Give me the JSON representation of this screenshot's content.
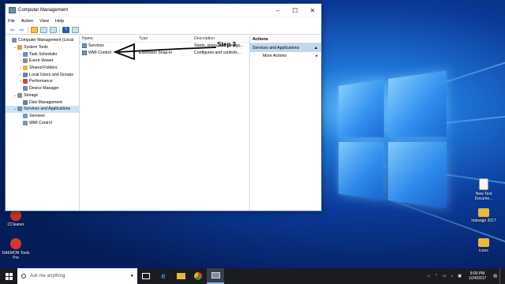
{
  "window": {
    "title": "Computer Management",
    "menu": [
      "File",
      "Action",
      "View",
      "Help"
    ]
  },
  "tree": [
    {
      "label": "Computer Management (Local",
      "depth": 0,
      "expand": "",
      "icon": "computer-icon",
      "color": "#7a8fa6"
    },
    {
      "label": "System Tools",
      "depth": 1,
      "expand": "v",
      "icon": "tools-icon",
      "color": "#c9a24a"
    },
    {
      "label": "Task Scheduler",
      "depth": 2,
      "expand": ">",
      "icon": "clock-icon",
      "color": "#6b8cb8"
    },
    {
      "label": "Event Viewer",
      "depth": 2,
      "expand": ">",
      "icon": "event-icon",
      "color": "#8a8a8a"
    },
    {
      "label": "Shared Folders",
      "depth": 2,
      "expand": ">",
      "icon": "folder-icon",
      "color": "#e8b93a"
    },
    {
      "label": "Local Users and Groups",
      "depth": 2,
      "expand": ">",
      "icon": "users-icon",
      "color": "#5f86c4"
    },
    {
      "label": "Performance",
      "depth": 2,
      "expand": ">",
      "icon": "performance-icon",
      "color": "#d0453a"
    },
    {
      "label": "Device Manager",
      "depth": 2,
      "expand": "",
      "icon": "device-icon",
      "color": "#6f8aa0"
    },
    {
      "label": "Storage",
      "depth": 1,
      "expand": "v",
      "icon": "storage-icon",
      "color": "#8a8a8a"
    },
    {
      "label": "Disk Management",
      "depth": 2,
      "expand": "",
      "icon": "disk-icon",
      "color": "#6d7f92"
    },
    {
      "label": "Services and Applications",
      "depth": 1,
      "expand": "v",
      "icon": "services-apps-icon",
      "color": "#7a8fa6",
      "selected": true
    },
    {
      "label": "Services",
      "depth": 2,
      "expand": "",
      "icon": "services-icon",
      "color": "#7d96b0"
    },
    {
      "label": "WMI Control",
      "depth": 2,
      "expand": "",
      "icon": "wmi-icon",
      "color": "#7d96b0"
    }
  ],
  "list": {
    "columns": [
      "Name",
      "Type",
      "Description"
    ],
    "rows": [
      {
        "name": "Services",
        "type": "",
        "description": "Starts, stops, and configu..."
      },
      {
        "name": "WMI Control",
        "type": "Extension Snap-in",
        "description": "Configures and controls..."
      }
    ]
  },
  "actions": {
    "header": "Actions",
    "section": "Services and Applications",
    "items": [
      "More Actions"
    ]
  },
  "annotation": {
    "label": "Step 3"
  },
  "desktop_icons": [
    {
      "label": "CCleaner",
      "name": "ccleaner-icon",
      "color": "#c7352b"
    },
    {
      "label": "DAEMON Tools Pro",
      "name": "daemon-tools-icon",
      "color": "#d23b2c"
    },
    {
      "label": "New Text Docume...",
      "name": "text-document-icon",
      "color": "#f2f2f2"
    },
    {
      "label": "Indesign 2017",
      "name": "folder-icon",
      "color": "#e8b93a"
    },
    {
      "label": "icons",
      "name": "folder-icon",
      "color": "#e8b93a"
    }
  ],
  "taskbar": {
    "search_placeholder": "Ask me anything",
    "time": "8:00 PM",
    "date": "1/24/2017"
  }
}
